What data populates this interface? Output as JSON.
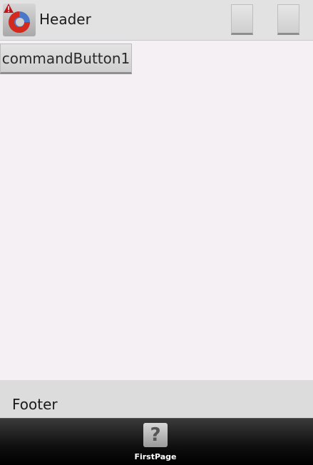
{
  "header": {
    "title": "Header"
  },
  "content": {
    "command_button_label": "commandButton1"
  },
  "footer": {
    "label": "Footer"
  },
  "tabbar": {
    "items": [
      {
        "label": "FirstPage",
        "icon": "question-mark-icon",
        "icon_glyph": "?"
      }
    ]
  },
  "colors": {
    "background": "#f4f0f3",
    "header_bg": "#e2e2e2",
    "footer_bg": "#dcdcdc",
    "tabbar_bg": "#0f0f0f"
  }
}
